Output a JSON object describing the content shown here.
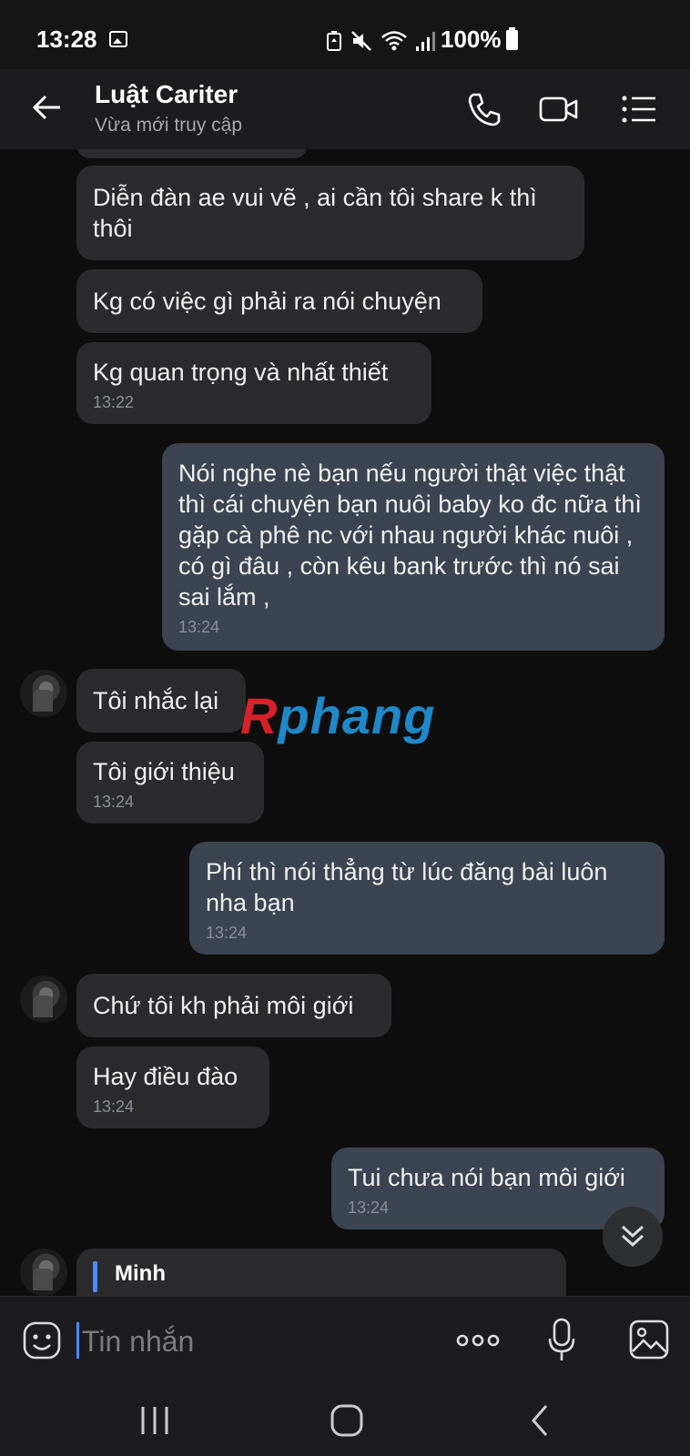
{
  "status_bar": {
    "time": "13:28",
    "battery": "100%"
  },
  "header": {
    "contact_name": "Luật Cariter",
    "presence": "Vừa mới truy cập"
  },
  "messages": [
    {
      "direction": "in",
      "text": "Diễn đàn ae vui vẽ , ai cần tôi share k thì thôi",
      "time": ""
    },
    {
      "direction": "in",
      "text": "Kg có việc gì phải ra nói chuyện",
      "time": ""
    },
    {
      "direction": "in",
      "text": "Kg quan trọng và nhất thiết",
      "time": "13:22"
    },
    {
      "direction": "out",
      "text": "Nói nghe nè bạn nếu người thật việc thật thì cái chuyện bạn nuôi baby ko đc nữa thì gặp cà phê nc với nhau người khác nuôi , có gì đâu , còn kêu bank trước thì nó sai sai lắm ,",
      "time": "13:24"
    },
    {
      "direction": "in",
      "text": "Tôi nhắc lại",
      "time": ""
    },
    {
      "direction": "in",
      "text": "Tôi giới thiệu",
      "time": "13:24"
    },
    {
      "direction": "out",
      "text": "Phí thì nói thẳng từ lúc đăng bài luôn nha bạn",
      "time": "13:24"
    },
    {
      "direction": "in",
      "text": "Chứ tôi kh phải môi giới",
      "time": ""
    },
    {
      "direction": "in",
      "text": "Hay điều đào",
      "time": "13:24"
    },
    {
      "direction": "out",
      "text": "Tui chưa nói bạn môi giới",
      "time": "13:24"
    },
    {
      "direction": "in",
      "reply_to": "Minh",
      "text": "",
      "time": ""
    }
  ],
  "watermark": {
    "text": "Rphang",
    "colors": [
      "#d8202a",
      "#1e88c8"
    ]
  },
  "composer": {
    "placeholder": "Tin nhắn"
  },
  "colors": {
    "incoming_bubble": "#2b2b2d",
    "outgoing_bubble": "#3b4450",
    "accent": "#4a8cff"
  },
  "icons": [
    "back-arrow-icon",
    "phone-icon",
    "video-camera-icon",
    "menu-list-icon",
    "emoji-icon",
    "more-dots-icon",
    "microphone-icon",
    "gallery-icon",
    "scroll-down-chevrons-icon",
    "recents-icon",
    "home-icon",
    "nav-back-icon"
  ]
}
